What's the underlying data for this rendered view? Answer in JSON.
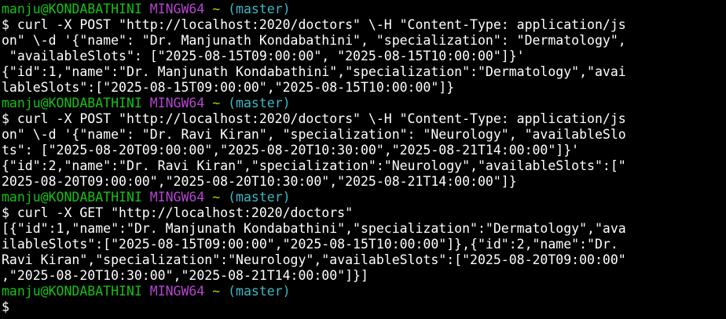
{
  "colors": {
    "background": "#000000",
    "text": "#ffffff",
    "prompt_user": "#13c213",
    "prompt_system": "#b545d2",
    "prompt_path": "#c6c600",
    "prompt_branch": "#3bb8c6"
  },
  "prompt": {
    "user_host": "manju@KONDABATHINI",
    "system": "MINGW64",
    "path": "~",
    "branch": "(master)"
  },
  "lines": {
    "l02": "$ curl -X POST \"http://localhost:2020/doctors\" \\-H \"Content-Type: application/js",
    "l03": "on\" \\-d '{\"name\": \"Dr. Manjunath Kondabathini\", \"specialization\": \"Dermatology\",",
    "l04": " \"availableSlots\": [\"2025-08-15T09:00:00\", \"2025-08-15T10:00:00\"]}'",
    "l05": "{\"id\":1,\"name\":\"Dr. Manjunath Kondabathini\",\"specialization\":\"Dermatology\",\"avai",
    "l06": "lableSlots\":[\"2025-08-15T09:00:00\",\"2025-08-15T10:00:00\"]}",
    "l08": "$ curl -X POST \"http://localhost:2020/doctors\" \\-H \"Content-Type: application/js",
    "l09": "on\" \\-d '{\"name\": \"Dr. Ravi Kiran\", \"specialization\": \"Neurology\", \"availableSlo",
    "l10": "ts\": [\"2025-08-20T09:00:00\",\"2025-08-20T10:30:00\",\"2025-08-21T14:00:00\"]}'",
    "l11": "{\"id\":2,\"name\":\"Dr. Ravi Kiran\",\"specialization\":\"Neurology\",\"availableSlots\":[\"",
    "l12": "2025-08-20T09:00:00\",\"2025-08-20T10:30:00\",\"2025-08-21T14:00:00\"]}",
    "l14": "$ curl -X GET \"http://localhost:2020/doctors\"",
    "l15": "[{\"id\":1,\"name\":\"Dr. Manjunath Kondabathini\",\"specialization\":\"Dermatology\",\"ava",
    "l16": "ilableSlots\":[\"2025-08-15T09:00:00\",\"2025-08-15T10:00:00\"]},{\"id\":2,\"name\":\"Dr.",
    "l17": "Ravi Kiran\",\"specialization\":\"Neurology\",\"availableSlots\":[\"2025-08-20T09:00:00\"",
    "l18": ",\"2025-08-20T10:30:00\",\"2025-08-21T14:00:00\"]}]",
    "l20": "$"
  }
}
